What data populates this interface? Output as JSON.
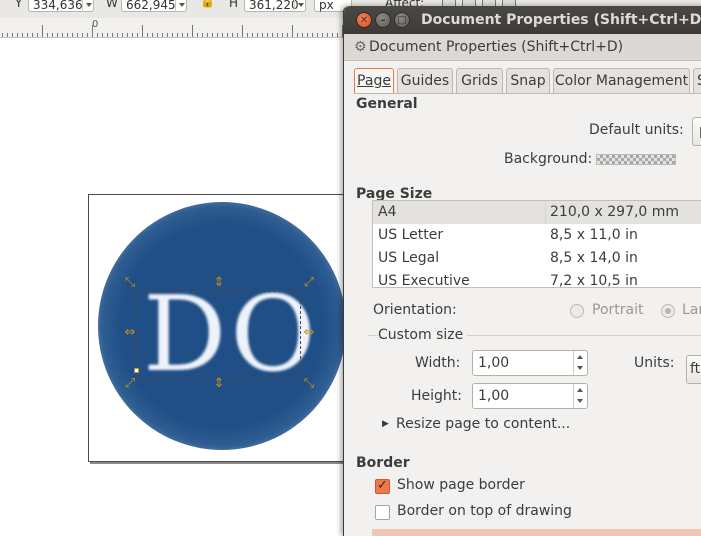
{
  "toolbar": {
    "y_label": "Y",
    "y_value": "334,636",
    "w_label": "W",
    "w_value": "662,945",
    "h_label": "H",
    "h_value": "361,220",
    "unit_value": "px",
    "affect_label": "Affect:"
  },
  "ruler": {
    "zero_label": "0"
  },
  "canvas": {
    "logo_text": "DO"
  },
  "dialog": {
    "title": "Document Properties (Shift+Ctrl+D)",
    "dock_title": "Document Properties (Shift+Ctrl+D)",
    "tabs": [
      {
        "label": "Page"
      },
      {
        "label": "Guides"
      },
      {
        "label": "Grids"
      },
      {
        "label": "Snap"
      },
      {
        "label": "Color Management"
      },
      {
        "label": "S"
      }
    ],
    "general": {
      "heading": "General",
      "default_units_label": "Default units:",
      "default_units_value": "p",
      "background_label": "Background:"
    },
    "page_size": {
      "heading": "Page Size",
      "rows": [
        {
          "name": "A4",
          "size": "210,0 x 297,0 mm"
        },
        {
          "name": "US Letter",
          "size": "8,5 x 11,0 in"
        },
        {
          "name": "US Legal",
          "size": "8,5 x 14,0 in"
        },
        {
          "name": "US Executive",
          "size": "7,2 x 10,5 in"
        }
      ],
      "orientation_label": "Orientation:",
      "portrait_label": "Portrait",
      "landscape_label": "Lar"
    },
    "custom_size": {
      "heading": "Custom size",
      "width_label": "Width:",
      "width_value": "1,00",
      "height_label": "Height:",
      "height_value": "1,00",
      "units_label": "Units:",
      "units_value": "ft",
      "resize_label": "Resize page to content..."
    },
    "border": {
      "heading": "Border",
      "show_border_label": "Show page border",
      "border_on_top_label": "Border on top of drawing"
    }
  },
  "colors": {
    "accent": "#f07746",
    "titlebar": "#3c3b37",
    "logo_blue": "#1f4f86"
  }
}
